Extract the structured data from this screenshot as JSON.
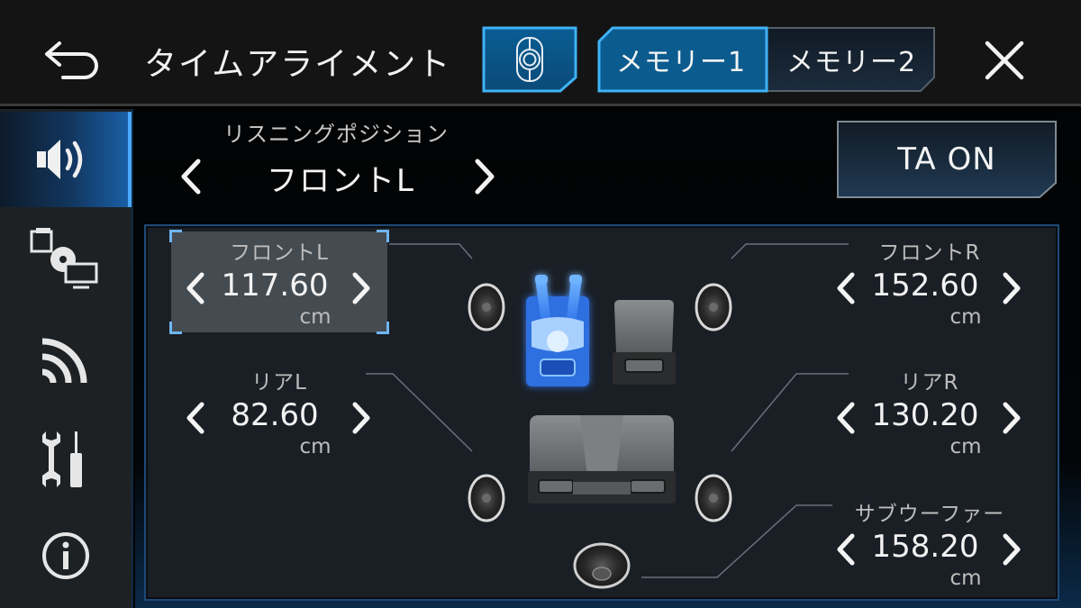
{
  "header": {
    "title": "タイムアライメント",
    "back_icon": "back-arrow-icon",
    "seat_select_icon": "seat-icon",
    "memory_tabs": [
      {
        "label": "メモリー1",
        "selected": true
      },
      {
        "label": "メモリー2",
        "selected": false
      }
    ],
    "close_icon": "close-icon"
  },
  "sidebar": {
    "items": [
      {
        "icon": "speaker-icon",
        "name": "audio",
        "active": true
      },
      {
        "icon": "media-source-icon",
        "name": "source",
        "active": false
      },
      {
        "icon": "wireless-signal-icon",
        "name": "connectivity",
        "active": false
      },
      {
        "icon": "tools-icon",
        "name": "system-settings",
        "active": false
      },
      {
        "icon": "info-icon",
        "name": "information",
        "active": false
      }
    ]
  },
  "listening_position": {
    "label": "リスニングポジション",
    "value": "フロントL"
  },
  "ta_button": {
    "label": "TA ON"
  },
  "channels": {
    "front_l": {
      "name": "フロントL",
      "value": "117.60",
      "unit": "cm",
      "selected": true
    },
    "front_r": {
      "name": "フロントR",
      "value": "152.60",
      "unit": "cm",
      "selected": false
    },
    "rear_l": {
      "name": "リアL",
      "value": "82.60",
      "unit": "cm",
      "selected": false
    },
    "rear_r": {
      "name": "リアR",
      "value": "130.20",
      "unit": "cm",
      "selected": false
    },
    "subwoofer": {
      "name": "サブウーファー",
      "value": "158.20",
      "unit": "cm",
      "selected": false
    }
  },
  "colors": {
    "accent": "#1a8ad8",
    "selected_tab": "#0d5a8c",
    "highlight_seat": "#3a8cff"
  }
}
